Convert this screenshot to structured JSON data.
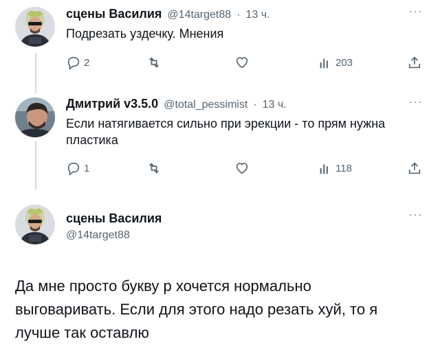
{
  "tweet1": {
    "name": "сцены Василия",
    "handle": "@14target88",
    "time": "13 ч.",
    "text": "Подрезать уздечку. Мнения",
    "replies": "2",
    "views": "203"
  },
  "tweet2": {
    "name": "Дмитрий v3.5.0",
    "handle": "@total_pessimist",
    "time": "13 ч.",
    "text": "Если натягивается сильно при эрекции - то прям нужна пластика",
    "replies": "1",
    "views": "118"
  },
  "tweet3": {
    "name": "сцены Василия",
    "handle": "@14target88",
    "text": "Да мне просто букву р хочется нормально выговаривать. Если для этого надо резать хуй, то я лучше так оставлю"
  },
  "sep": "·",
  "more": "···",
  "colors": {
    "text": "#0f1419",
    "muted": "#536471",
    "line": "#cfd9de"
  }
}
